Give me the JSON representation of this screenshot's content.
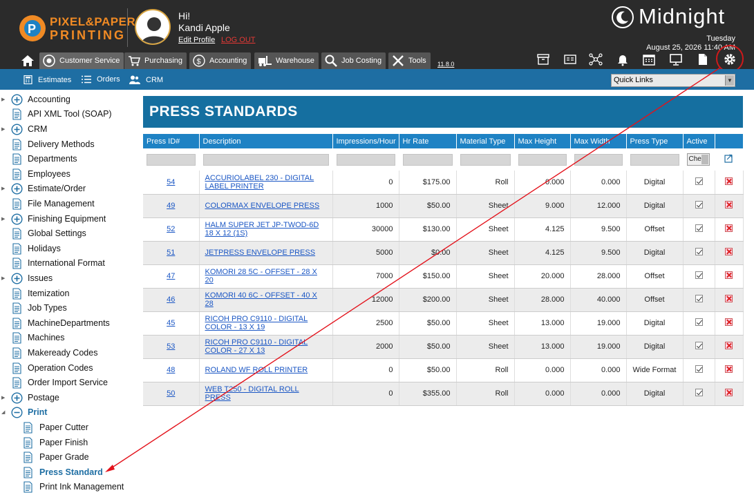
{
  "header": {
    "logo_line1": "PIXEL&PAPER",
    "logo_line2": "PRINTING",
    "greeting": "Hi!",
    "user_name": "Kandi Apple",
    "edit_profile": "Edit Profile",
    "logout": "LOG OUT",
    "brand": "Midnight",
    "day": "Tuesday",
    "datetime": "August 25, 2026 11:40 AM",
    "version": "11.8.0"
  },
  "nav": {
    "items": [
      {
        "label": "Customer Service",
        "icon": "headset-icon"
      },
      {
        "label": "Purchasing",
        "icon": "cart-icon"
      },
      {
        "label": "Accounting",
        "icon": "dollar-icon"
      },
      {
        "label": "Warehouse",
        "icon": "forklift-icon"
      },
      {
        "label": "Job Costing",
        "icon": "magnifier-icon"
      },
      {
        "label": "Tools",
        "icon": "tools-icon"
      }
    ],
    "right_icons": [
      "archive-icon",
      "id-card-icon",
      "network-icon",
      "bell-icon",
      "calendar-icon",
      "monitor-icon",
      "document-icon",
      "gear-icon"
    ]
  },
  "subnav": {
    "items": [
      {
        "label": "Estimates",
        "icon": "calculator-icon"
      },
      {
        "label": "Orders",
        "icon": "list-icon"
      },
      {
        "label": "CRM",
        "icon": "people-icon"
      }
    ],
    "quick_links": "Quick Links"
  },
  "sidebar": {
    "items": [
      {
        "label": "Accounting",
        "type": "group"
      },
      {
        "label": "API XML Tool (SOAP)",
        "type": "page"
      },
      {
        "label": "CRM",
        "type": "group"
      },
      {
        "label": "Delivery Methods",
        "type": "page"
      },
      {
        "label": "Departments",
        "type": "page"
      },
      {
        "label": "Employees",
        "type": "page"
      },
      {
        "label": "Estimate/Order",
        "type": "group"
      },
      {
        "label": "File Management",
        "type": "page"
      },
      {
        "label": "Finishing Equipment",
        "type": "group"
      },
      {
        "label": "Global Settings",
        "type": "page"
      },
      {
        "label": "Holidays",
        "type": "page"
      },
      {
        "label": "International Format",
        "type": "page"
      },
      {
        "label": "Issues",
        "type": "group"
      },
      {
        "label": "Itemization",
        "type": "page"
      },
      {
        "label": "Job Types",
        "type": "page"
      },
      {
        "label": "MachineDepartments",
        "type": "page"
      },
      {
        "label": "Machines",
        "type": "page"
      },
      {
        "label": "Makeready Codes",
        "type": "page"
      },
      {
        "label": "Operation Codes",
        "type": "page"
      },
      {
        "label": "Order Import Service",
        "type": "page"
      },
      {
        "label": "Postage",
        "type": "group"
      },
      {
        "label": "Print",
        "type": "open"
      },
      {
        "label": "Paper Cutter",
        "type": "child"
      },
      {
        "label": "Paper Finish",
        "type": "child"
      },
      {
        "label": "Paper Grade",
        "type": "child"
      },
      {
        "label": "Press Standard",
        "type": "child-selected"
      },
      {
        "label": "Print Ink Management",
        "type": "child"
      }
    ]
  },
  "page": {
    "title": "PRESS STANDARDS",
    "active_filter": "Che",
    "columns": [
      "Press ID#",
      "Description",
      "Impressions/Hour",
      "Hr Rate",
      "Material Type",
      "Max Height",
      "Max Width",
      "Press Type",
      "Active",
      ""
    ],
    "rows": [
      {
        "id": "54",
        "description": "ACCURIOLABEL 230 - DIGITAL LABEL PRINTER",
        "impressions": "0",
        "rate": "$175.00",
        "material": "Roll",
        "height": "0.000",
        "width": "0.000",
        "type": "Digital"
      },
      {
        "id": "49",
        "description": "COLORMAX ENVELOPE PRESS",
        "impressions": "1000",
        "rate": "$50.00",
        "material": "Sheet",
        "height": "9.000",
        "width": "12.000",
        "type": "Digital"
      },
      {
        "id": "52",
        "description": "HALM SUPER JET JP-TWOD-6D 18 X 12 (1S)",
        "impressions": "30000",
        "rate": "$130.00",
        "material": "Sheet",
        "height": "4.125",
        "width": "9.500",
        "type": "Offset"
      },
      {
        "id": "51",
        "description": "JETPRESS ENVELOPE PRESS",
        "impressions": "5000",
        "rate": "$0.00",
        "material": "Sheet",
        "height": "4.125",
        "width": "9.500",
        "type": "Digital"
      },
      {
        "id": "47",
        "description": "KOMORI 28 5C - OFFSET - 28 X 20",
        "impressions": "7000",
        "rate": "$150.00",
        "material": "Sheet",
        "height": "20.000",
        "width": "28.000",
        "type": "Offset"
      },
      {
        "id": "46",
        "description": "KOMORI 40 6C - OFFSET - 40 X 28",
        "impressions": "12000",
        "rate": "$200.00",
        "material": "Sheet",
        "height": "28.000",
        "width": "40.000",
        "type": "Offset"
      },
      {
        "id": "45",
        "description": "RICOH PRO C9110 - DIGITAL COLOR - 13 X 19",
        "impressions": "2500",
        "rate": "$50.00",
        "material": "Sheet",
        "height": "13.000",
        "width": "19.000",
        "type": "Digital"
      },
      {
        "id": "53",
        "description": "RICOH PRO C9110 - DIGITAL COLOR - 27 X 13",
        "impressions": "2000",
        "rate": "$50.00",
        "material": "Sheet",
        "height": "13.000",
        "width": "19.000",
        "type": "Digital"
      },
      {
        "id": "48",
        "description": "ROLAND WF ROLL PRINTER",
        "impressions": "0",
        "rate": "$50.00",
        "material": "Roll",
        "height": "0.000",
        "width": "0.000",
        "type": "Wide Format"
      },
      {
        "id": "50",
        "description": "WEB T250 - DIGITAL ROLL PRESS",
        "impressions": "0",
        "rate": "$355.00",
        "material": "Roll",
        "height": "0.000",
        "width": "0.000",
        "type": "Digital"
      }
    ]
  },
  "colors": {
    "topbar": "#2b2b2b",
    "accent": "#1e6ea3",
    "annotation": "#d0191a"
  }
}
